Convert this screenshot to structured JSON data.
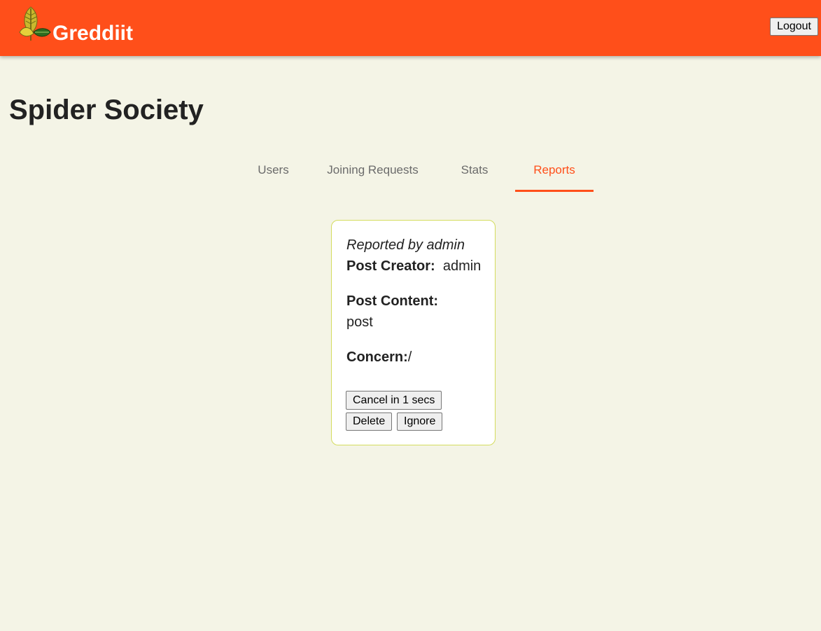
{
  "header": {
    "brand": "Greddiit",
    "logout_label": "Logout",
    "bar_color": "#ff4f1a",
    "logo_icon": "leaf-logo-icon"
  },
  "page": {
    "title": "Spider Society"
  },
  "tabs": [
    {
      "label": "Users",
      "active": false
    },
    {
      "label": "Joining Requests",
      "active": false
    },
    {
      "label": "Stats",
      "active": false
    },
    {
      "label": "Reports",
      "active": true
    }
  ],
  "report": {
    "reported_by": "Reported by admin",
    "post_creator_label": "Post Creator:",
    "post_creator": "admin",
    "post_content_label": "Post Content:",
    "post_content": "post",
    "concern_label": "Concern:",
    "concern": "/",
    "cancel_label": "Cancel in 1 secs",
    "delete_label": "Delete",
    "ignore_label": "Ignore"
  }
}
